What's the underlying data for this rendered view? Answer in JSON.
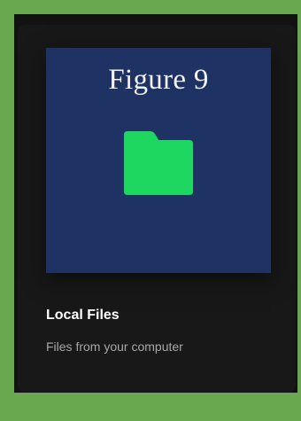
{
  "card": {
    "cover_caption": "Figure 9",
    "title": "Local Files",
    "subtitle": "Files from your computer",
    "icon": "folder-icon"
  },
  "colors": {
    "frame_border": "#6aa84f",
    "page_background": "#121212",
    "card_background": "#181818",
    "cover_background": "#1e3264",
    "folder_green": "#1ed760",
    "title_text": "#ffffff",
    "subtitle_text": "#a7a7a7"
  }
}
